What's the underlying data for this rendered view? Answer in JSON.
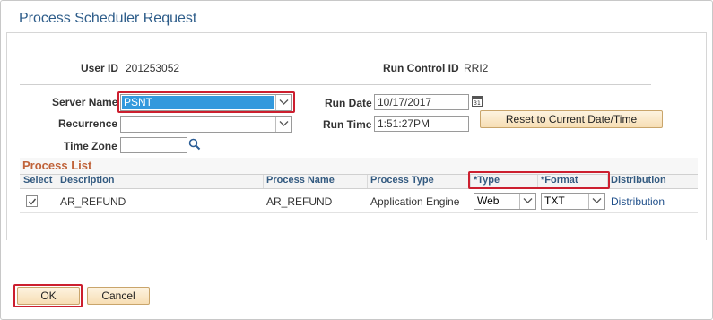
{
  "page": {
    "title": "Process Scheduler Request"
  },
  "header": {
    "user_id_label": "User ID",
    "user_id_value": "201253052",
    "run_control_label": "Run Control ID",
    "run_control_value": "RRI2"
  },
  "form": {
    "server_name_label": "Server Name",
    "server_name_value": "PSNT",
    "recurrence_label": "Recurrence",
    "recurrence_value": "",
    "time_zone_label": "Time Zone",
    "time_zone_value": "",
    "run_date_label": "Run Date",
    "run_date_value": "10/17/2017",
    "run_time_label": "Run Time",
    "run_time_value": "1:51:27PM",
    "reset_button_label": "Reset to Current Date/Time"
  },
  "process_list": {
    "title": "Process List",
    "columns": [
      "Select",
      "Description",
      "Process Name",
      "Process Type",
      "*Type",
      "*Format",
      "Distribution"
    ],
    "rows": [
      {
        "selected": true,
        "description": "AR_REFUND",
        "process_name": "AR_REFUND",
        "process_type": "Application Engine",
        "type": "Web",
        "format": "TXT",
        "distribution": "Distribution"
      }
    ]
  },
  "actions": {
    "ok_label": "OK",
    "cancel_label": "Cancel"
  },
  "colors": {
    "title": "#2e5d8a",
    "section_title": "#c0633a",
    "highlight_border": "#cc1f2f",
    "selection": "#3399dd",
    "button_bg": "#f7deb4",
    "link": "#1f4f8a"
  },
  "icons": {
    "calendar": "calendar-icon",
    "lookup": "magnifier-icon",
    "dropdown": "chevron-down-icon",
    "checkbox": "checkmark-icon"
  }
}
